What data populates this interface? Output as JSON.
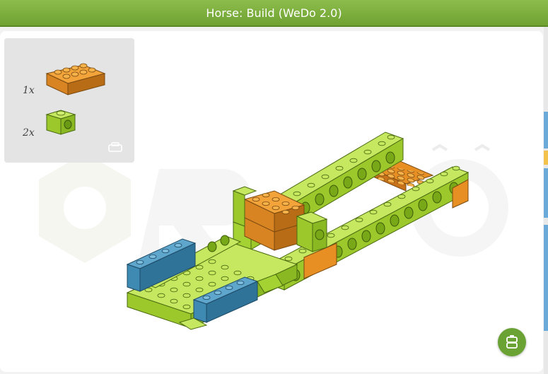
{
  "window": {
    "title": "Horse: Build (WeDo 2.0)"
  },
  "parts_panel": {
    "items": [
      {
        "quantity": "1x",
        "part": "orange 2x4 brick"
      },
      {
        "quantity": "2x",
        "part": "lime 1x1 technic brick"
      }
    ]
  },
  "colors": {
    "title_bar": "#7ab03e",
    "lime": "#a4d233",
    "orange": "#d9831c",
    "blue": "#3f8ab3",
    "fab": "#6aa233"
  },
  "icons": {
    "parts_toggle": "brick-icon",
    "fab": "brick-icon"
  }
}
